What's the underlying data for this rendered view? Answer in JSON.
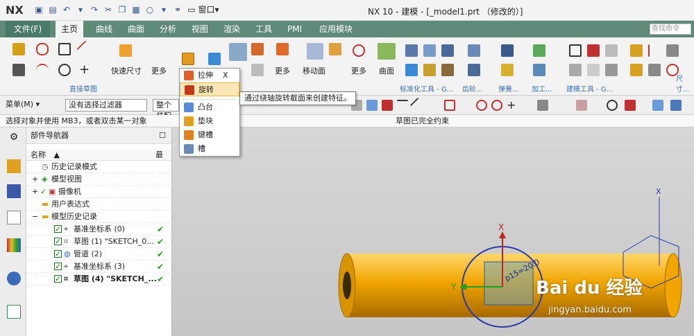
{
  "app": {
    "logo": "NX",
    "window_title": "NX 10 - 建模 - [_model1.prt  （修改的）]",
    "viewport_status": "草图已完全约束"
  },
  "menu": {
    "file_label": "文件(F)",
    "tabs": [
      "主页",
      "曲线",
      "曲面",
      "分析",
      "视图",
      "渲染",
      "工具",
      "PMI",
      "应用模块"
    ],
    "search_placeholder": "查找命令"
  },
  "ribbon": {
    "groups": [
      "直接草图",
      "标准化工具 - G...",
      "齿轮...",
      "弹簧...",
      "加工...",
      "建模工具 - G...",
      "尺寸..."
    ],
    "buttons": [
      "快速尺寸",
      "更多",
      "更多",
      "移动面",
      "更多",
      "曲面"
    ]
  },
  "toolbar2": {
    "menu_label": "菜单(M)",
    "filter": "没有选择过滤器",
    "assembly": "整个装配"
  },
  "status_prompt": "选择对象并使用 MB3，或者双击某一对象",
  "navigator": {
    "title": "部件导航器",
    "col_name": "名称",
    "col_latest": "最",
    "items": [
      {
        "label": "历史记录模式",
        "level": 1,
        "check": false,
        "ok": false
      },
      {
        "label": "模型视图",
        "level": 1,
        "check": false,
        "ok": false
      },
      {
        "label": "摄像机",
        "level": 1,
        "check": true,
        "ok": false
      },
      {
        "label": "用户表达式",
        "level": 1,
        "check": false,
        "ok": false
      },
      {
        "label": "模型历史记录",
        "level": 1,
        "check": false,
        "ok": false
      },
      {
        "label": "基准坐标系 (0)",
        "level": 2,
        "check": true,
        "ok": true
      },
      {
        "label": "草图 (1) \"SKETCH_0...",
        "level": 2,
        "check": true,
        "ok": true
      },
      {
        "label": "管道 (2)",
        "level": 2,
        "check": true,
        "ok": true
      },
      {
        "label": "基准坐标系 (3)",
        "level": 2,
        "check": true,
        "ok": true
      },
      {
        "label": "草图 (4) \"SKETCH_...",
        "level": 2,
        "check": true,
        "ok": true
      }
    ]
  },
  "popup": {
    "items": [
      {
        "label": "拉伸",
        "shortcut": "X"
      },
      {
        "label": "旋转",
        "shortcut": ""
      },
      {
        "label": "凸台",
        "shortcut": ""
      },
      {
        "label": "垫块",
        "shortcut": ""
      },
      {
        "label": "键槽",
        "shortcut": ""
      },
      {
        "label": "槽",
        "shortcut": ""
      }
    ],
    "tooltip": "通过绕轴旋转截面来创建特征。"
  },
  "viewport": {
    "axis_x": "X",
    "axis_y": "Y",
    "dim_label": "p15=20.0"
  },
  "watermark": {
    "text": "Bai du 经验",
    "url": "jingyan.baidu.com"
  },
  "colors": {
    "ribbon_tab_bar": "#5f8a7a",
    "pipe": "#e8a000",
    "selection": "#fbe7b5"
  }
}
